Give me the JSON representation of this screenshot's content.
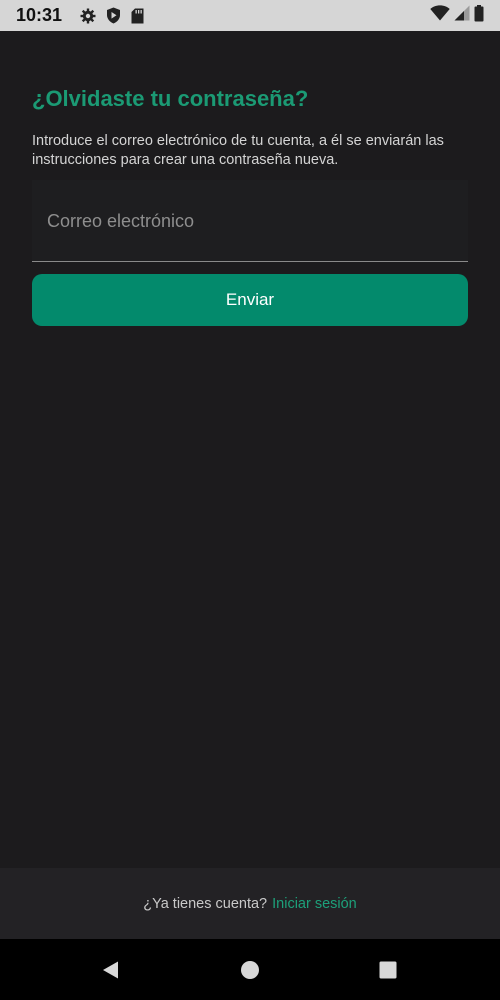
{
  "status_bar": {
    "time": "10:31",
    "icons": [
      "gear-icon",
      "shield-play-icon",
      "sd-card-icon",
      "wifi-icon",
      "signal-icon",
      "battery-icon"
    ]
  },
  "main": {
    "title": "¿Olvidaste tu contraseña?",
    "description": "Introduce el correo electrónico de tu cuenta, a él se enviarán las instrucciones para crear una contraseña nueva.",
    "email_placeholder": "Correo electrónico",
    "email_value": "",
    "send_label": "Enviar"
  },
  "footer": {
    "prompt": "¿Ya tienes cuenta?",
    "login_link": "Iniciar sesión"
  },
  "nav_bar": {
    "icons": [
      "back-icon",
      "home-icon",
      "recents-icon"
    ]
  },
  "colors": {
    "accent": "#1b9a74",
    "button": "#038a6c",
    "background": "#1c1b1d",
    "footer": "#232225"
  }
}
